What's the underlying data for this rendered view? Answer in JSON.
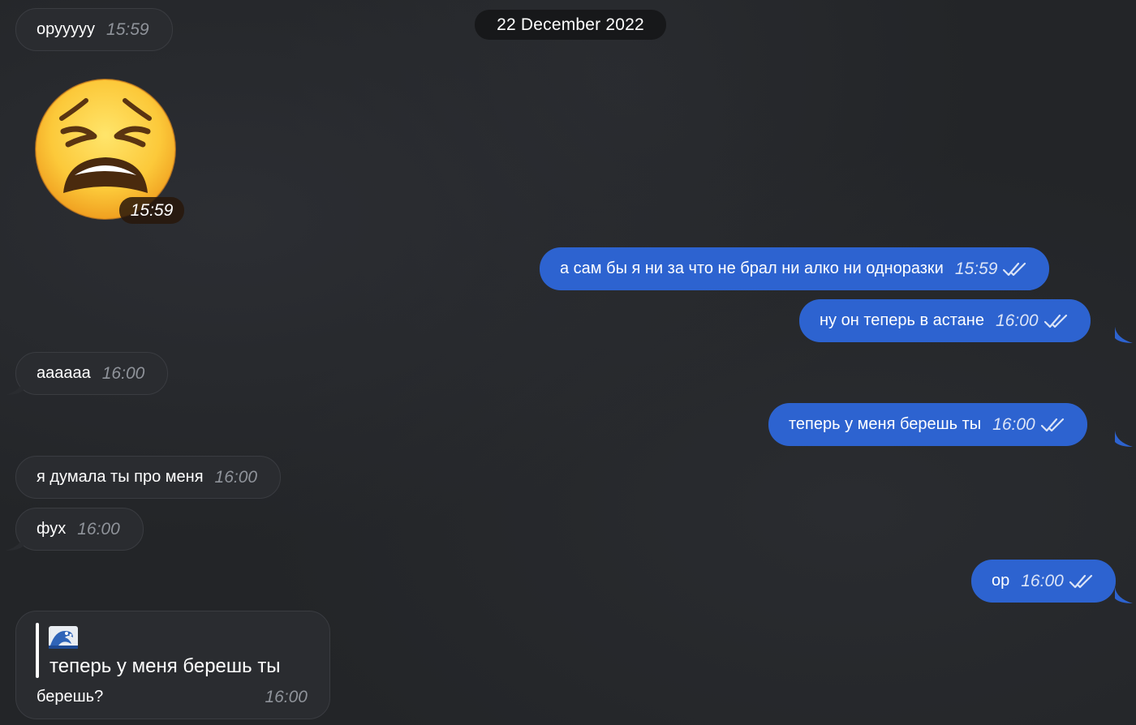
{
  "date_separator": "22 December 2022",
  "colors": {
    "background": "#232528",
    "incoming_bubble": "#2a2c30",
    "outgoing_bubble": "#2d63d0",
    "date_pill": "#17181a"
  },
  "messages": [
    {
      "direction": "incoming",
      "text": "орууууу",
      "time": "15:59"
    },
    {
      "direction": "incoming",
      "type": "sticker",
      "sticker": "weary-face-emoji",
      "time": "15:59"
    },
    {
      "direction": "outgoing",
      "text": "а сам бы я ни за что не брал ни алко ни одноразки",
      "time": "15:59",
      "status": "read"
    },
    {
      "direction": "outgoing",
      "text": "ну он теперь в астане",
      "time": "16:00",
      "status": "read"
    },
    {
      "direction": "incoming",
      "text": "аааааа",
      "time": "16:00"
    },
    {
      "direction": "outgoing",
      "text": "теперь у меня берешь ты",
      "time": "16:00",
      "status": "read"
    },
    {
      "direction": "incoming",
      "text": "я думала ты про меня",
      "time": "16:00"
    },
    {
      "direction": "incoming",
      "text": "фух",
      "time": "16:00"
    },
    {
      "direction": "outgoing",
      "text": "ор",
      "time": "16:00",
      "status": "read"
    },
    {
      "direction": "incoming",
      "type": "reply",
      "reply_sticker": "wave-icon",
      "reply_quote": "теперь у меня берешь ты",
      "text": "берешь?",
      "time": "16:00"
    }
  ]
}
